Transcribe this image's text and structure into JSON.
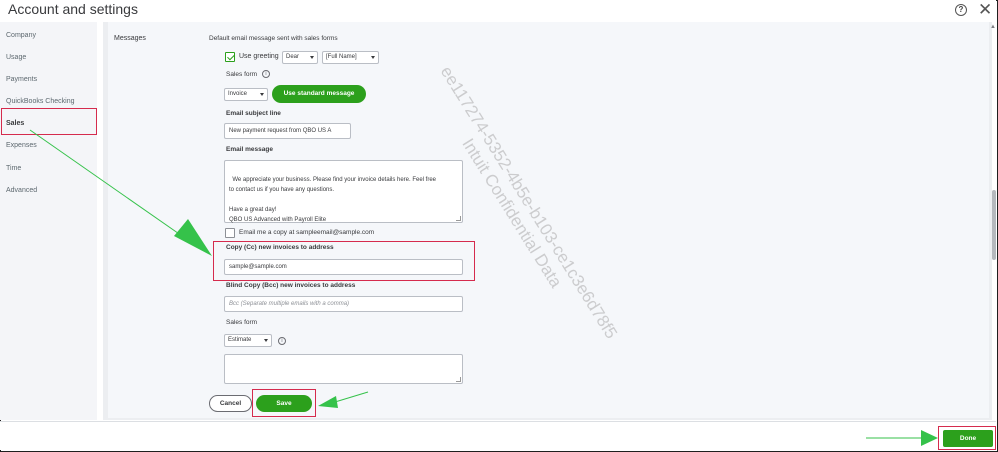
{
  "window": {
    "title": "Account and settings",
    "help_icon": "help-icon",
    "close_icon": "close-icon",
    "close_glyph": "✕",
    "help_glyph": "?"
  },
  "sidebar": {
    "items": [
      {
        "label": "Company"
      },
      {
        "label": "Usage"
      },
      {
        "label": "Payments"
      },
      {
        "label": "QuickBooks Checking"
      },
      {
        "label": "Sales",
        "active": true
      },
      {
        "label": "Expenses"
      },
      {
        "label": "Time"
      },
      {
        "label": "Advanced"
      }
    ]
  },
  "messages": {
    "section_label": "Messages",
    "intro": "Default email message sent with sales forms",
    "use_greeting_label": "Use greeting",
    "use_greeting_checked": true,
    "greeting_select": "Dear",
    "name_select": "[Full Name]",
    "sales_form_label": "Sales form",
    "sales_form_select": "Invoice",
    "use_standard_button": "Use standard message",
    "email_subject_label": "Email subject line",
    "email_subject_value": "New payment request from QBO US A",
    "email_message_label": "Email message",
    "email_message_value": "We appreciate your business. Please find your invoice details here. Feel free\nto contact us if you have any questions.\n\nHave a great day!\nQBO US Advanced with Payroll Elite",
    "email_copy_label": "Email me a copy at sampleemail@sample.com",
    "email_copy_checked": false,
    "cc_label": "Copy (Cc) new invoices to address",
    "cc_value": "sample@sample.com",
    "bcc_label": "Blind Copy (Bcc) new invoices to address",
    "bcc_placeholder": "Bcc (Separate multiple emails with a comma)",
    "sales_form2_label": "Sales form",
    "sales_form2_select": "Estimate",
    "estimate_message_value": ""
  },
  "actions": {
    "cancel_label": "Cancel",
    "save_label": "Save"
  },
  "footer": {
    "done_label": "Done"
  },
  "watermark": {
    "line1": "ee117274-5352-4b5e-b103-ce1c3e6d78f5",
    "line2": "Intuit Confidential Data"
  },
  "colors": {
    "accent_green": "#2ca01c",
    "highlight_red": "#d52b4d",
    "arrow_green": "#35c24a"
  }
}
